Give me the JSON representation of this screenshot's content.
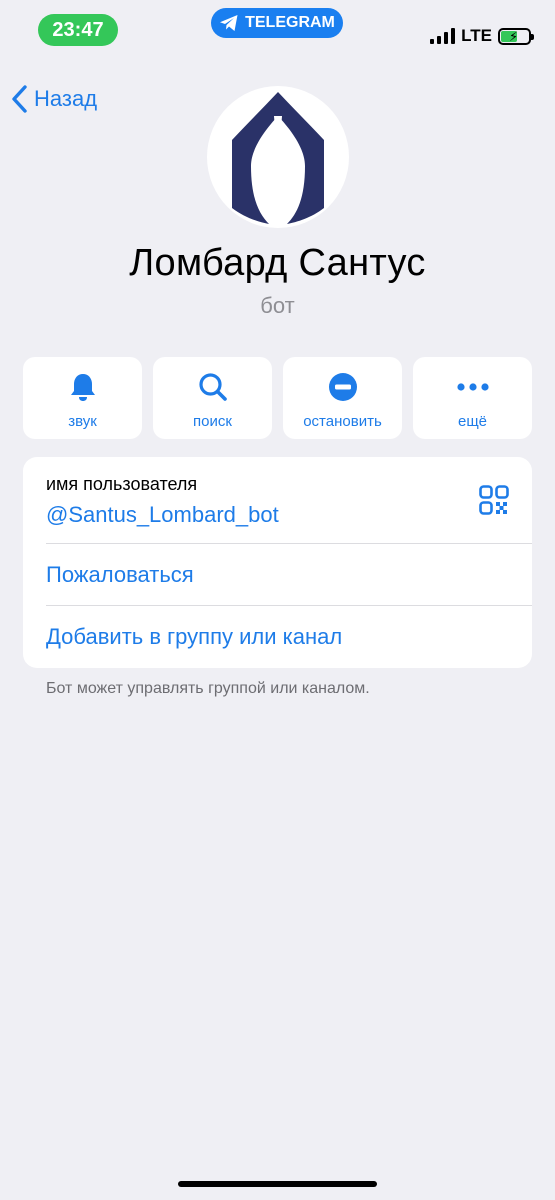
{
  "status_bar": {
    "time": "23:47",
    "app_pill": "TELEGRAM",
    "network": "LTE",
    "colors": {
      "time_pill": "#34c759",
      "app_pill": "#1a7ff0"
    }
  },
  "nav": {
    "back_label": "Назад"
  },
  "profile": {
    "name": "Ломбард Сантус",
    "subtitle": "бот"
  },
  "actions": [
    {
      "label": "звук",
      "icon": "bell-icon"
    },
    {
      "label": "поиск",
      "icon": "search-icon"
    },
    {
      "label": "остановить",
      "icon": "stop-icon"
    },
    {
      "label": "ещё",
      "icon": "more-icon"
    }
  ],
  "info": {
    "username_caption": "имя пользователя",
    "username": "@Santus_Lombard_bot",
    "report": "Пожаловаться",
    "add_to_group": "Добавить в группу или канал"
  },
  "footnote": "Бот может управлять группой или каналом.",
  "accent_color": "#1e7ce8"
}
